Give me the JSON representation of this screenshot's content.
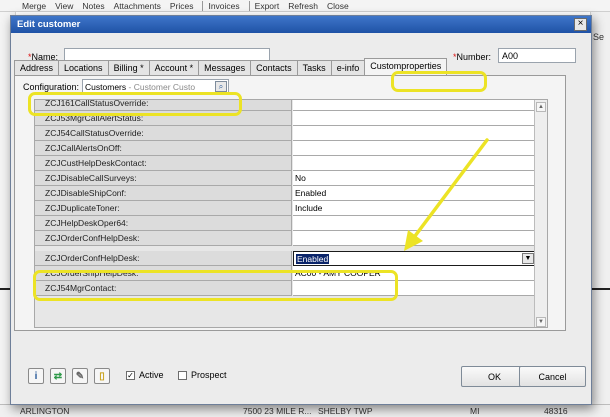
{
  "background": {
    "menu_items": [
      "Merge",
      "View",
      "Notes",
      "Attachments",
      "Prices",
      "Invoices",
      "Export",
      "Refresh",
      "Close"
    ],
    "side_text": "Se",
    "bottom_row": {
      "city": "ARLINGTON",
      "address": "7500 23 MILE R...",
      "township": "SHELBY TWP",
      "state": "MI",
      "zip": "48316"
    }
  },
  "dialog": {
    "title": "Edit customer",
    "close_glyph": "×",
    "name_label": "Name:",
    "name_value": "",
    "number_label": "Number:",
    "number_value": "A00",
    "required_mark": "*"
  },
  "tabs": [
    {
      "label": "Address",
      "active": false
    },
    {
      "label": "Locations",
      "active": false
    },
    {
      "label": "Billing *",
      "active": false
    },
    {
      "label": "Account *",
      "active": false
    },
    {
      "label": "Messages",
      "active": false
    },
    {
      "label": "Contacts",
      "active": false
    },
    {
      "label": "Tasks",
      "active": false
    },
    {
      "label": "e-info",
      "active": false
    },
    {
      "label": "Customproperties",
      "active": true
    }
  ],
  "configuration": {
    "label": "Configuration:",
    "value": "Customers",
    "hint": "- Customer Custo"
  },
  "properties": [
    {
      "name": "ZCJ161CallStatusOverride:",
      "value": ""
    },
    {
      "name": "ZCJ53MgrCallAlertStatus:",
      "value": ""
    },
    {
      "name": "ZCJ54CallStatusOverride:",
      "value": ""
    },
    {
      "name": "ZCJCallAlertsOnOff:",
      "value": ""
    },
    {
      "name": "ZCJCustHelpDeskContact:",
      "value": ""
    },
    {
      "name": "ZCJDisableCallSurveys:",
      "value": "No"
    },
    {
      "name": "ZCJDisableShipConf:",
      "value": "Enabled"
    },
    {
      "name": "ZCJDuplicateToner:",
      "value": "Include"
    },
    {
      "name": "ZCJHelpDeskOper64:",
      "value": ""
    },
    {
      "name": "ZCJOrderConfHelpDesk:",
      "value": ""
    },
    {
      "name": "ZCJOrderConfHelpDesk:",
      "value": "Enabled",
      "dropdown": true
    },
    {
      "name": "ZCJOrderShipHelpDesk:",
      "value": "AC00 - AMY COOPER"
    },
    {
      "name": "ZCJ54MgrContact:",
      "value": ""
    }
  ],
  "footer": {
    "active_label": "Active",
    "active_checked": true,
    "prospect_label": "Prospect",
    "prospect_checked": false,
    "ok_label": "OK",
    "cancel_label": "Cancel",
    "check_glyph": "✓"
  },
  "colors": {
    "highlight": "#ece325",
    "titlebar": "#1f52a6",
    "arrow": "#ece325"
  }
}
